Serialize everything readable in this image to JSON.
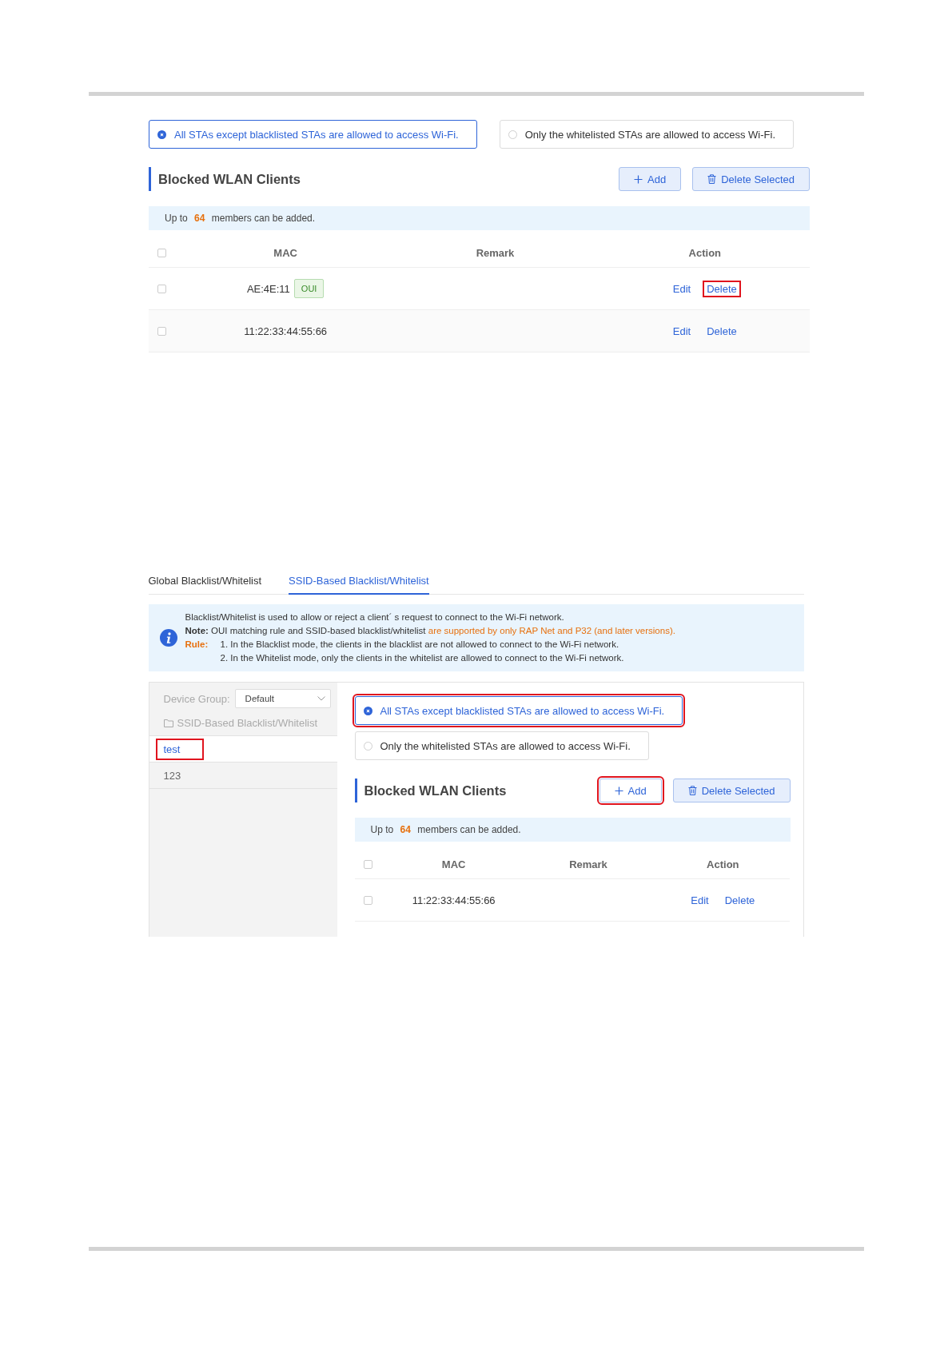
{
  "figure_1": {
    "modes": [
      {
        "label": "All STAs except blacklisted STAs are allowed to access Wi-Fi.",
        "selected": true,
        "highlighted": false
      },
      {
        "label": "Only the whitelisted STAs are allowed to access Wi-Fi.",
        "selected": false,
        "highlighted": false
      }
    ],
    "section_title": "Blocked WLAN Clients",
    "buttons": [
      {
        "kind": "add",
        "label": "Add",
        "highlighted": false
      },
      {
        "kind": "delete",
        "label": "Delete Selected",
        "highlighted": false
      }
    ],
    "notice": "Up to **64** members can be added.",
    "columns": [
      "MAC",
      "Remark",
      "Action"
    ],
    "all_checked": false,
    "rows": [
      {
        "checked": false,
        "mac": "AE:4E:11",
        "tag": "OUI",
        "actions": [
          {
            "label": "Edit",
            "highlighted": false
          },
          {
            "label": "Delete",
            "highlighted": true
          }
        ]
      },
      {
        "checked": false,
        "mac": "11:22:33:44:55:66",
        "actions": [
          {
            "label": "Edit",
            "highlighted": false
          },
          {
            "label": "Delete",
            "highlighted": false
          }
        ]
      }
    ]
  },
  "figure_2": {
    "tabs": [
      {
        "label": "Global Blacklist/Whitelist",
        "selected": false
      },
      {
        "label": "SSID-Based Blacklist/Whitelist",
        "selected": true
      }
    ],
    "info": {
      "intro": "Blacklist/Whitelist is used to allow or reject a client´ s request to connect to the Wi-Fi network.",
      "note_label": "Note:",
      "note_text": "OUI matching rule and SSID-based blacklist/whitelist",
      "note_emphasis": "are supported by only RAP Net and P32 (and later versions).",
      "rule_label": "Rule:",
      "rules": [
        "1. In the Blacklist mode, the clients in the blacklist are not allowed to connect to the Wi-Fi network.",
        "2. In the Whitelist mode, only the clients in the whitelist are allowed to connect to the Wi-Fi network."
      ]
    },
    "sidebar": {
      "group_label": "Device Group:",
      "group_value": "Default",
      "folder": "SSID-Based Blacklist/Whitelist",
      "items": [
        {
          "label": "test",
          "selected": true,
          "highlighted": true
        },
        {
          "label": "123",
          "selected": false,
          "highlighted": false
        }
      ]
    },
    "pane": {
      "modes": [
        {
          "label": "All STAs except blacklisted STAs are allowed to access Wi-Fi.",
          "selected": true,
          "highlighted": true
        },
        {
          "label": "Only the whitelisted STAs are allowed to access Wi-Fi.",
          "selected": false,
          "highlighted": false
        }
      ],
      "section_title": "Blocked WLAN Clients",
      "buttons": [
        {
          "kind": "add",
          "label": "Add",
          "highlighted": true
        },
        {
          "kind": "delete",
          "label": "Delete Selected",
          "highlighted": false
        }
      ],
      "notice": "Up to **64** members can be added.",
      "columns": [
        "MAC",
        "Remark",
        "Action"
      ],
      "all_checked": false,
      "rows": [
        {
          "checked": false,
          "mac": "11:22:33:44:55:66",
          "actions": [
            {
              "label": "Edit",
              "highlighted": false
            },
            {
              "label": "Delete",
              "highlighted": false
            }
          ]
        }
      ]
    }
  }
}
